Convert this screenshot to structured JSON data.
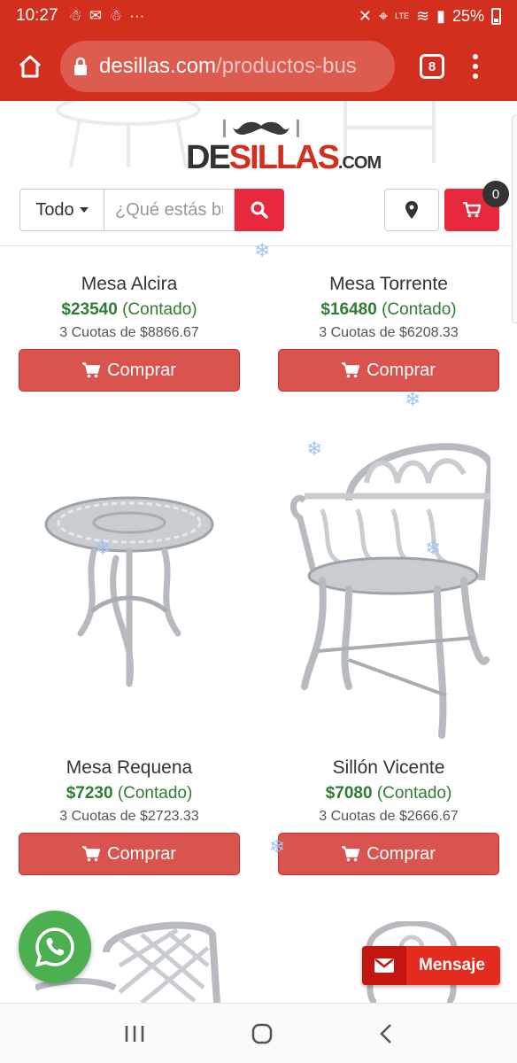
{
  "status_bar": {
    "time": "10:27",
    "battery": "25%",
    "network": "LTE"
  },
  "browser": {
    "url_host": "desillas.com",
    "url_path": "/productos-bus",
    "tab_count": "8"
  },
  "site": {
    "logo_de": "DE",
    "logo_sillas": "SILLAS",
    "logo_com": ".COM",
    "category_selected": "Todo",
    "search_placeholder": "¿Qué estás buscando?",
    "cart_count": "0"
  },
  "products": [
    {
      "name": "Mesa Alcira",
      "price": "$23540",
      "price_suffix": "(Contado)",
      "cuotas": "3 Cuotas de $8866.67",
      "buy_label": "Comprar"
    },
    {
      "name": "Mesa Torrente",
      "price": "$16480",
      "price_suffix": "(Contado)",
      "cuotas": "3 Cuotas de $6208.33",
      "buy_label": "Comprar"
    },
    {
      "name": "Mesa Requena",
      "price": "$7230",
      "price_suffix": "(Contado)",
      "cuotas": "3 Cuotas de $2723.33",
      "buy_label": "Comprar"
    },
    {
      "name": "Sillón Vicente",
      "price": "$7080",
      "price_suffix": "(Contado)",
      "cuotas": "3 Cuotas de $2666.67",
      "buy_label": "Comprar"
    }
  ],
  "floating": {
    "message_label": "Mensaje"
  },
  "colors": {
    "brand_red": "#d32f1e",
    "button_red": "#d9534f",
    "price_green": "#2e7d32"
  }
}
